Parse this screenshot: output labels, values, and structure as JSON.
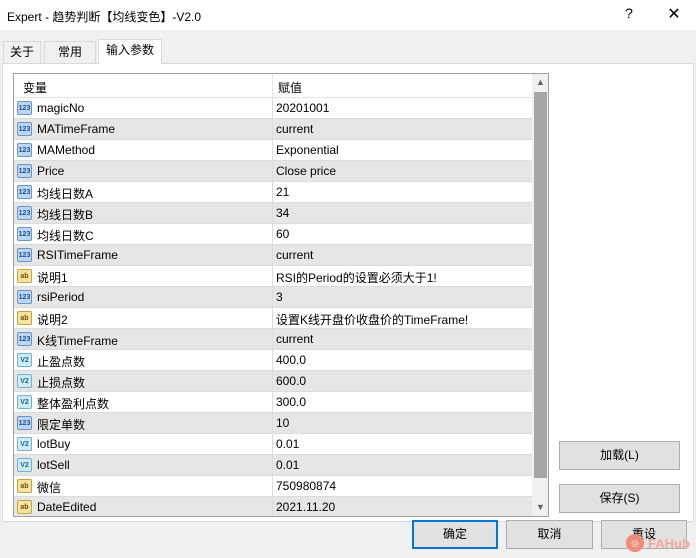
{
  "window": {
    "title": "Expert - 趋势判断【均线变色】-V2.0",
    "help_label": "?",
    "close_label": "✕"
  },
  "tabs": [
    {
      "label": "关于",
      "active": false
    },
    {
      "label": "常用",
      "active": false
    },
    {
      "label": "输入参数",
      "active": true
    }
  ],
  "grid": {
    "col_variable": "变量",
    "col_value": "赋值",
    "rows": [
      {
        "icon": "int-icon",
        "icon_text": "123",
        "name": "magicNo",
        "value": "20201001"
      },
      {
        "icon": "int-icon",
        "icon_text": "123",
        "name": "MATimeFrame",
        "value": "current"
      },
      {
        "icon": "int-icon",
        "icon_text": "123",
        "name": "MAMethod",
        "value": "Exponential"
      },
      {
        "icon": "int-icon",
        "icon_text": "123",
        "name": "Price",
        "value": "Close price"
      },
      {
        "icon": "int-icon",
        "icon_text": "123",
        "name": "均线日数A",
        "value": "21"
      },
      {
        "icon": "int-icon",
        "icon_text": "123",
        "name": "均线日数B",
        "value": "34"
      },
      {
        "icon": "int-icon",
        "icon_text": "123",
        "name": "均线日数C",
        "value": "60"
      },
      {
        "icon": "int-icon",
        "icon_text": "123",
        "name": "RSITimeFrame",
        "value": "current"
      },
      {
        "icon": "string-icon",
        "icon_text": "ab",
        "name": "说明1",
        "value": "RSI的Period的设置必须大于1!"
      },
      {
        "icon": "int-icon",
        "icon_text": "123",
        "name": "rsiPeriod",
        "value": "3"
      },
      {
        "icon": "string-icon",
        "icon_text": "ab",
        "name": "说明2",
        "value": "设置K线开盘价收盘价的TimeFrame!"
      },
      {
        "icon": "int-icon",
        "icon_text": "123",
        "name": "K线TimeFrame",
        "value": "current"
      },
      {
        "icon": "double-icon",
        "icon_text": "V2",
        "name": "止盈点数",
        "value": "400.0"
      },
      {
        "icon": "double-icon",
        "icon_text": "V2",
        "name": "止损点数",
        "value": "600.0"
      },
      {
        "icon": "double-icon",
        "icon_text": "V2",
        "name": "整体盈利点数",
        "value": "300.0"
      },
      {
        "icon": "int-icon",
        "icon_text": "123",
        "name": "限定单数",
        "value": "10"
      },
      {
        "icon": "double-icon",
        "icon_text": "V2",
        "name": "lotBuy",
        "value": "0.01"
      },
      {
        "icon": "double-icon",
        "icon_text": "V2",
        "name": "lotSell",
        "value": "0.01"
      },
      {
        "icon": "string-icon",
        "icon_text": "ab",
        "name": "微信",
        "value": "750980874"
      },
      {
        "icon": "string-icon",
        "icon_text": "ab",
        "name": "DateEdited",
        "value": "2021.11.20"
      }
    ]
  },
  "buttons": {
    "load": "加载(L)",
    "save": "保存(S)",
    "ok": "确定",
    "cancel": "取消",
    "reset": "重设"
  },
  "watermark": {
    "text": "FAHub"
  },
  "colors": {
    "accent": "#0078d7",
    "row_alt": "#e6e6e6",
    "scroll_thumb": "#a6a6a6"
  }
}
